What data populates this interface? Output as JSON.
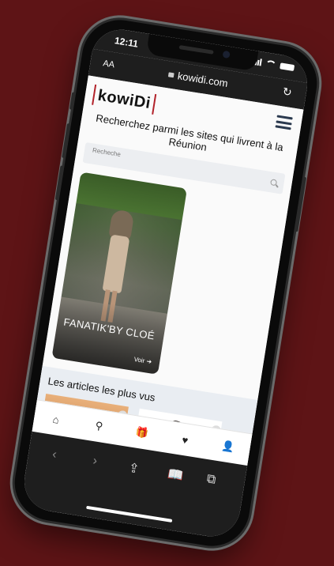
{
  "status": {
    "time": "12:11"
  },
  "browser": {
    "text_size_label": "AA",
    "url": "kowidi.com",
    "reload_icon": "reload-icon"
  },
  "site": {
    "logo": "kowiDi",
    "headline": "Recherchez parmi les sites qui livrent à la Réunion",
    "search_placeholder": "Recheche",
    "accent": "#b2222a"
  },
  "featured": {
    "brand": "FANATIK'BY CLOÉ",
    "cta": "Voir ➔"
  },
  "section": {
    "title": "Les articles les plus vus"
  },
  "nav": {
    "items": [
      "home-icon",
      "search-icon",
      "gift-icon",
      "heart-icon",
      "user-icon"
    ]
  },
  "toolbar": {
    "back": "‹",
    "forward": "›",
    "share": "⇪",
    "bookmarks": "📖",
    "tabs": "⧉"
  }
}
